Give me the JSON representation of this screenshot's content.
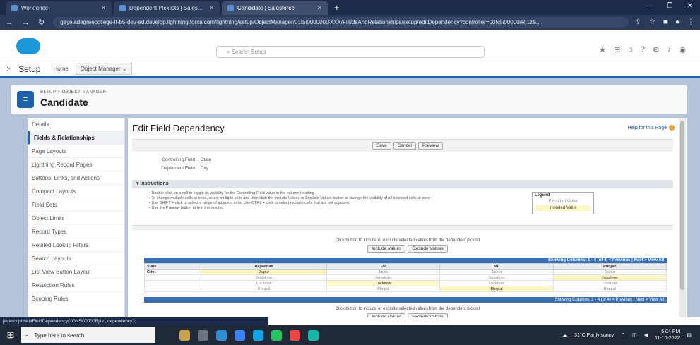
{
  "browser": {
    "tabs": [
      {
        "label": "Workfence"
      },
      {
        "label": "Dependent Picklists | Sales..."
      },
      {
        "label": "Candidate | Salesforce"
      }
    ],
    "url": "geyeladegreecollege-lt-b5-dev-ed.develop.lightning.force.com/lightning/setup/ObjectManager/01I5i000000UXXX/FieldsAndRelationships/setup/editDependency?controller=00N5i00000/Rj1z&..."
  },
  "header": {
    "search_placeholder": "Search Setup"
  },
  "appnav": {
    "title": "Setup",
    "items": [
      "Home",
      "Object Manager"
    ]
  },
  "page": {
    "breadcrumb": "SETUP > OBJECT MANAGER",
    "title": "Candidate"
  },
  "sidebar": {
    "items": [
      "Details",
      "Fields & Relationships",
      "Page Layouts",
      "Lightning Record Pages",
      "Buttons, Links, and Actions",
      "Compact Layouts",
      "Field Sets",
      "Object Limits",
      "Record Types",
      "Related Lookup Filters",
      "Search Layouts",
      "List View Button Layout",
      "Restriction Rules",
      "Scoping Rules"
    ]
  },
  "main": {
    "title": "Edit Field Dependency",
    "help": "Help for this Page",
    "buttons": [
      "Save",
      "Cancel",
      "Preview"
    ],
    "controlling_label": "Controlling Field",
    "controlling_value": "State",
    "dependent_label": "Dependent Field",
    "dependent_value": "City",
    "instructions_title": "Instructions",
    "instructions": [
      "Double click on a cell to toggle its visibility for the Controlling Field value in the column heading.",
      "To change multiple cells at once, select multiple cells and then click the Include Values or Exclude Values button to change the visibility of all selected cells at once.",
      "Use SHIFT + click to select a range of adjacent cells. Use CTRL + click to select multiple cells that are not adjacent.",
      "Use the Preview button to test the results."
    ],
    "legend_title": "Legend",
    "legend_excluded": "Excluded Value",
    "legend_included": "Included Value",
    "include_text": "Click button to include or exclude selected values from the dependent picklist",
    "include_button": "Include Values",
    "exclude_button": "Exclude Values",
    "showing_text": "Showing Columns: 1 - 4 (of 4) < Previous | Next > View All",
    "table": {
      "headers": [
        "State",
        "Rajasthan",
        "UP",
        "MP",
        "Punjab"
      ],
      "first_col_label": "City:",
      "rows": [
        [
          "Jaipur",
          "Jaipur",
          "Jaipur",
          "Jaipur"
        ],
        [
          "Jaisalmer",
          "Jaisalmer",
          "Jaisalmer",
          "Jaisalmer"
        ],
        [
          "Lucknow",
          "Lucknow",
          "Lucknow",
          "Lucknow"
        ],
        [
          "Bhopal",
          "Bhopal",
          "Bhopal",
          "Bhopal"
        ]
      ],
      "included": [
        [
          0,
          0
        ],
        [
          1,
          3
        ],
        [
          2,
          1
        ],
        [
          3,
          2
        ]
      ]
    }
  },
  "status_url": "javascript:hideFieldDependency('00N5i00000Rj1z','dependency');",
  "taskbar": {
    "search_text": "Type here to search",
    "weather": "31°C Partly sunny",
    "time": "5:04 PM",
    "date": "11-10-2022"
  }
}
